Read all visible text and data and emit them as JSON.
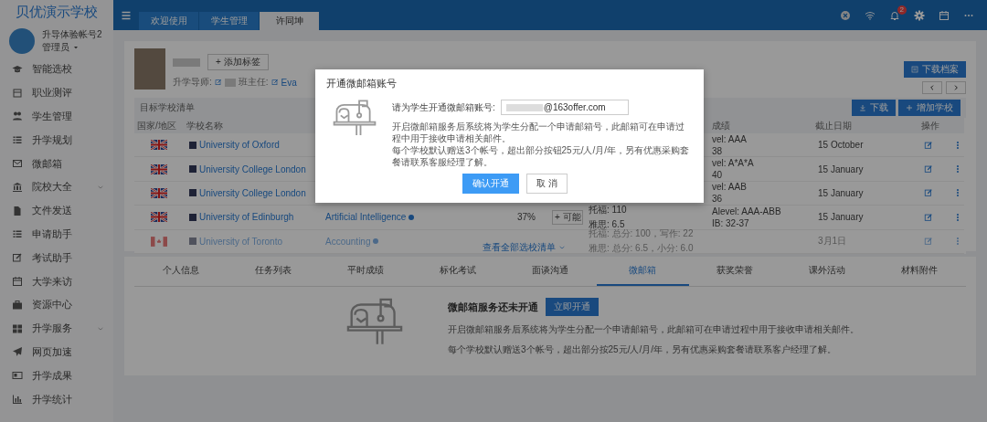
{
  "sidebar": {
    "brand": "贝优演示学校",
    "user": {
      "name": "升导体验帐号2",
      "role": "管理员"
    },
    "items": [
      {
        "label": "智能选校",
        "expandable": false
      },
      {
        "label": "职业测评",
        "expandable": false
      },
      {
        "label": "学生管理",
        "expandable": false
      },
      {
        "label": "升学规划",
        "expandable": false
      },
      {
        "label": "微邮箱",
        "expandable": false
      },
      {
        "label": "院校大全",
        "expandable": true
      },
      {
        "label": "文件发送",
        "expandable": false
      },
      {
        "label": "申请助手",
        "expandable": false
      },
      {
        "label": "考试助手",
        "expandable": false
      },
      {
        "label": "大学来访",
        "expandable": false
      },
      {
        "label": "资源中心",
        "expandable": false
      },
      {
        "label": "升学服务",
        "expandable": true
      },
      {
        "label": "网页加速",
        "expandable": false
      },
      {
        "label": "升学成果",
        "expandable": false
      },
      {
        "label": "升学统计",
        "expandable": false
      }
    ]
  },
  "topbar": {
    "tabs": [
      {
        "label": "欢迎使用",
        "selected": false
      },
      {
        "label": "学生管理",
        "selected": false
      },
      {
        "label": "许同坤",
        "selected": true
      }
    ],
    "notification_badge": "2"
  },
  "profile": {
    "add_tag": "+ 添加标签",
    "advisor_label": "升学导师:",
    "teacher_label": "班主任:",
    "teacher": "Eva",
    "download_button": "下载档案"
  },
  "school_list": {
    "title": "目标学校清单",
    "download_button": "下载",
    "add_button": "增加学校",
    "columns": [
      "国家/地区",
      "学校名称",
      "成绩",
      "截止日期",
      "操作"
    ],
    "rows": [
      {
        "kind": "uk",
        "school": "University of Oxford",
        "grades": [
          "vel: AAA",
          "38"
        ],
        "deadline": "15 October",
        "faded": false
      },
      {
        "kind": "uk",
        "school": "University College London",
        "grades": [
          "vel: A*A*A",
          "40"
        ],
        "deadline": "15 January",
        "faded": false
      },
      {
        "kind": "uk",
        "school": "University College London",
        "grades": [
          "vel: AAB",
          "36"
        ],
        "deadline": "15 January",
        "faded": false
      },
      {
        "kind": "uk",
        "school": "University of Edinburgh",
        "major": "Artificial Intelligence",
        "percent": "37%",
        "tag": "+ 可能",
        "language": [
          "托福: 110",
          "雅思: 6.5"
        ],
        "grades": [
          "Alevel: AAA-ABB",
          "IB: 32-37"
        ],
        "deadline": "15 January",
        "faded": false
      },
      {
        "kind": "ca",
        "school": "University of Toronto",
        "major": "Accounting",
        "language": [
          "托福: 总分: 100，写作: 22",
          "雅思: 总分: 6.5，小分: 6.0"
        ],
        "deadline": "3月1日",
        "faded": true
      }
    ],
    "view_all": "查看全部选校清单"
  },
  "detail_tabs": [
    {
      "label": "个人信息",
      "selected": false
    },
    {
      "label": "任务列表",
      "selected": false
    },
    {
      "label": "平时成绩",
      "selected": false
    },
    {
      "label": "标化考试",
      "selected": false
    },
    {
      "label": "面谈沟通",
      "selected": false
    },
    {
      "label": "微邮箱",
      "selected": true
    },
    {
      "label": "获奖荣誉",
      "selected": false
    },
    {
      "label": "课外活动",
      "selected": false
    },
    {
      "label": "材料附件",
      "selected": false
    }
  ],
  "mailbox_panel": {
    "heading": "微邮箱服务还未开通",
    "button": "立即开通",
    "lines": [
      "开启微邮箱服务后系统将为学生分配一个申请邮箱号，此邮箱可在申请过程中用于接收申请相关邮件。",
      "每个学校默认赠送3个帐号，超出部分按25元/人/月/年，另有优惠采购套餐请联系客户经理了解。"
    ]
  },
  "modal": {
    "title": "开通微邮箱账号",
    "field_label": "请为学生开通微邮箱账号:",
    "field_value": "@163offer.com",
    "lines": [
      "开启微邮箱服务后系统将为学生分配一个申请邮箱号，此邮箱可在申请过程中用于接收申请相关邮件。",
      "每个学校默认赠送3个帐号，超出部分按钮25元/人/月/年，另有优惠采购套餐请联系客服经理了解。"
    ],
    "confirm": "确认开通",
    "cancel": "取 消"
  }
}
